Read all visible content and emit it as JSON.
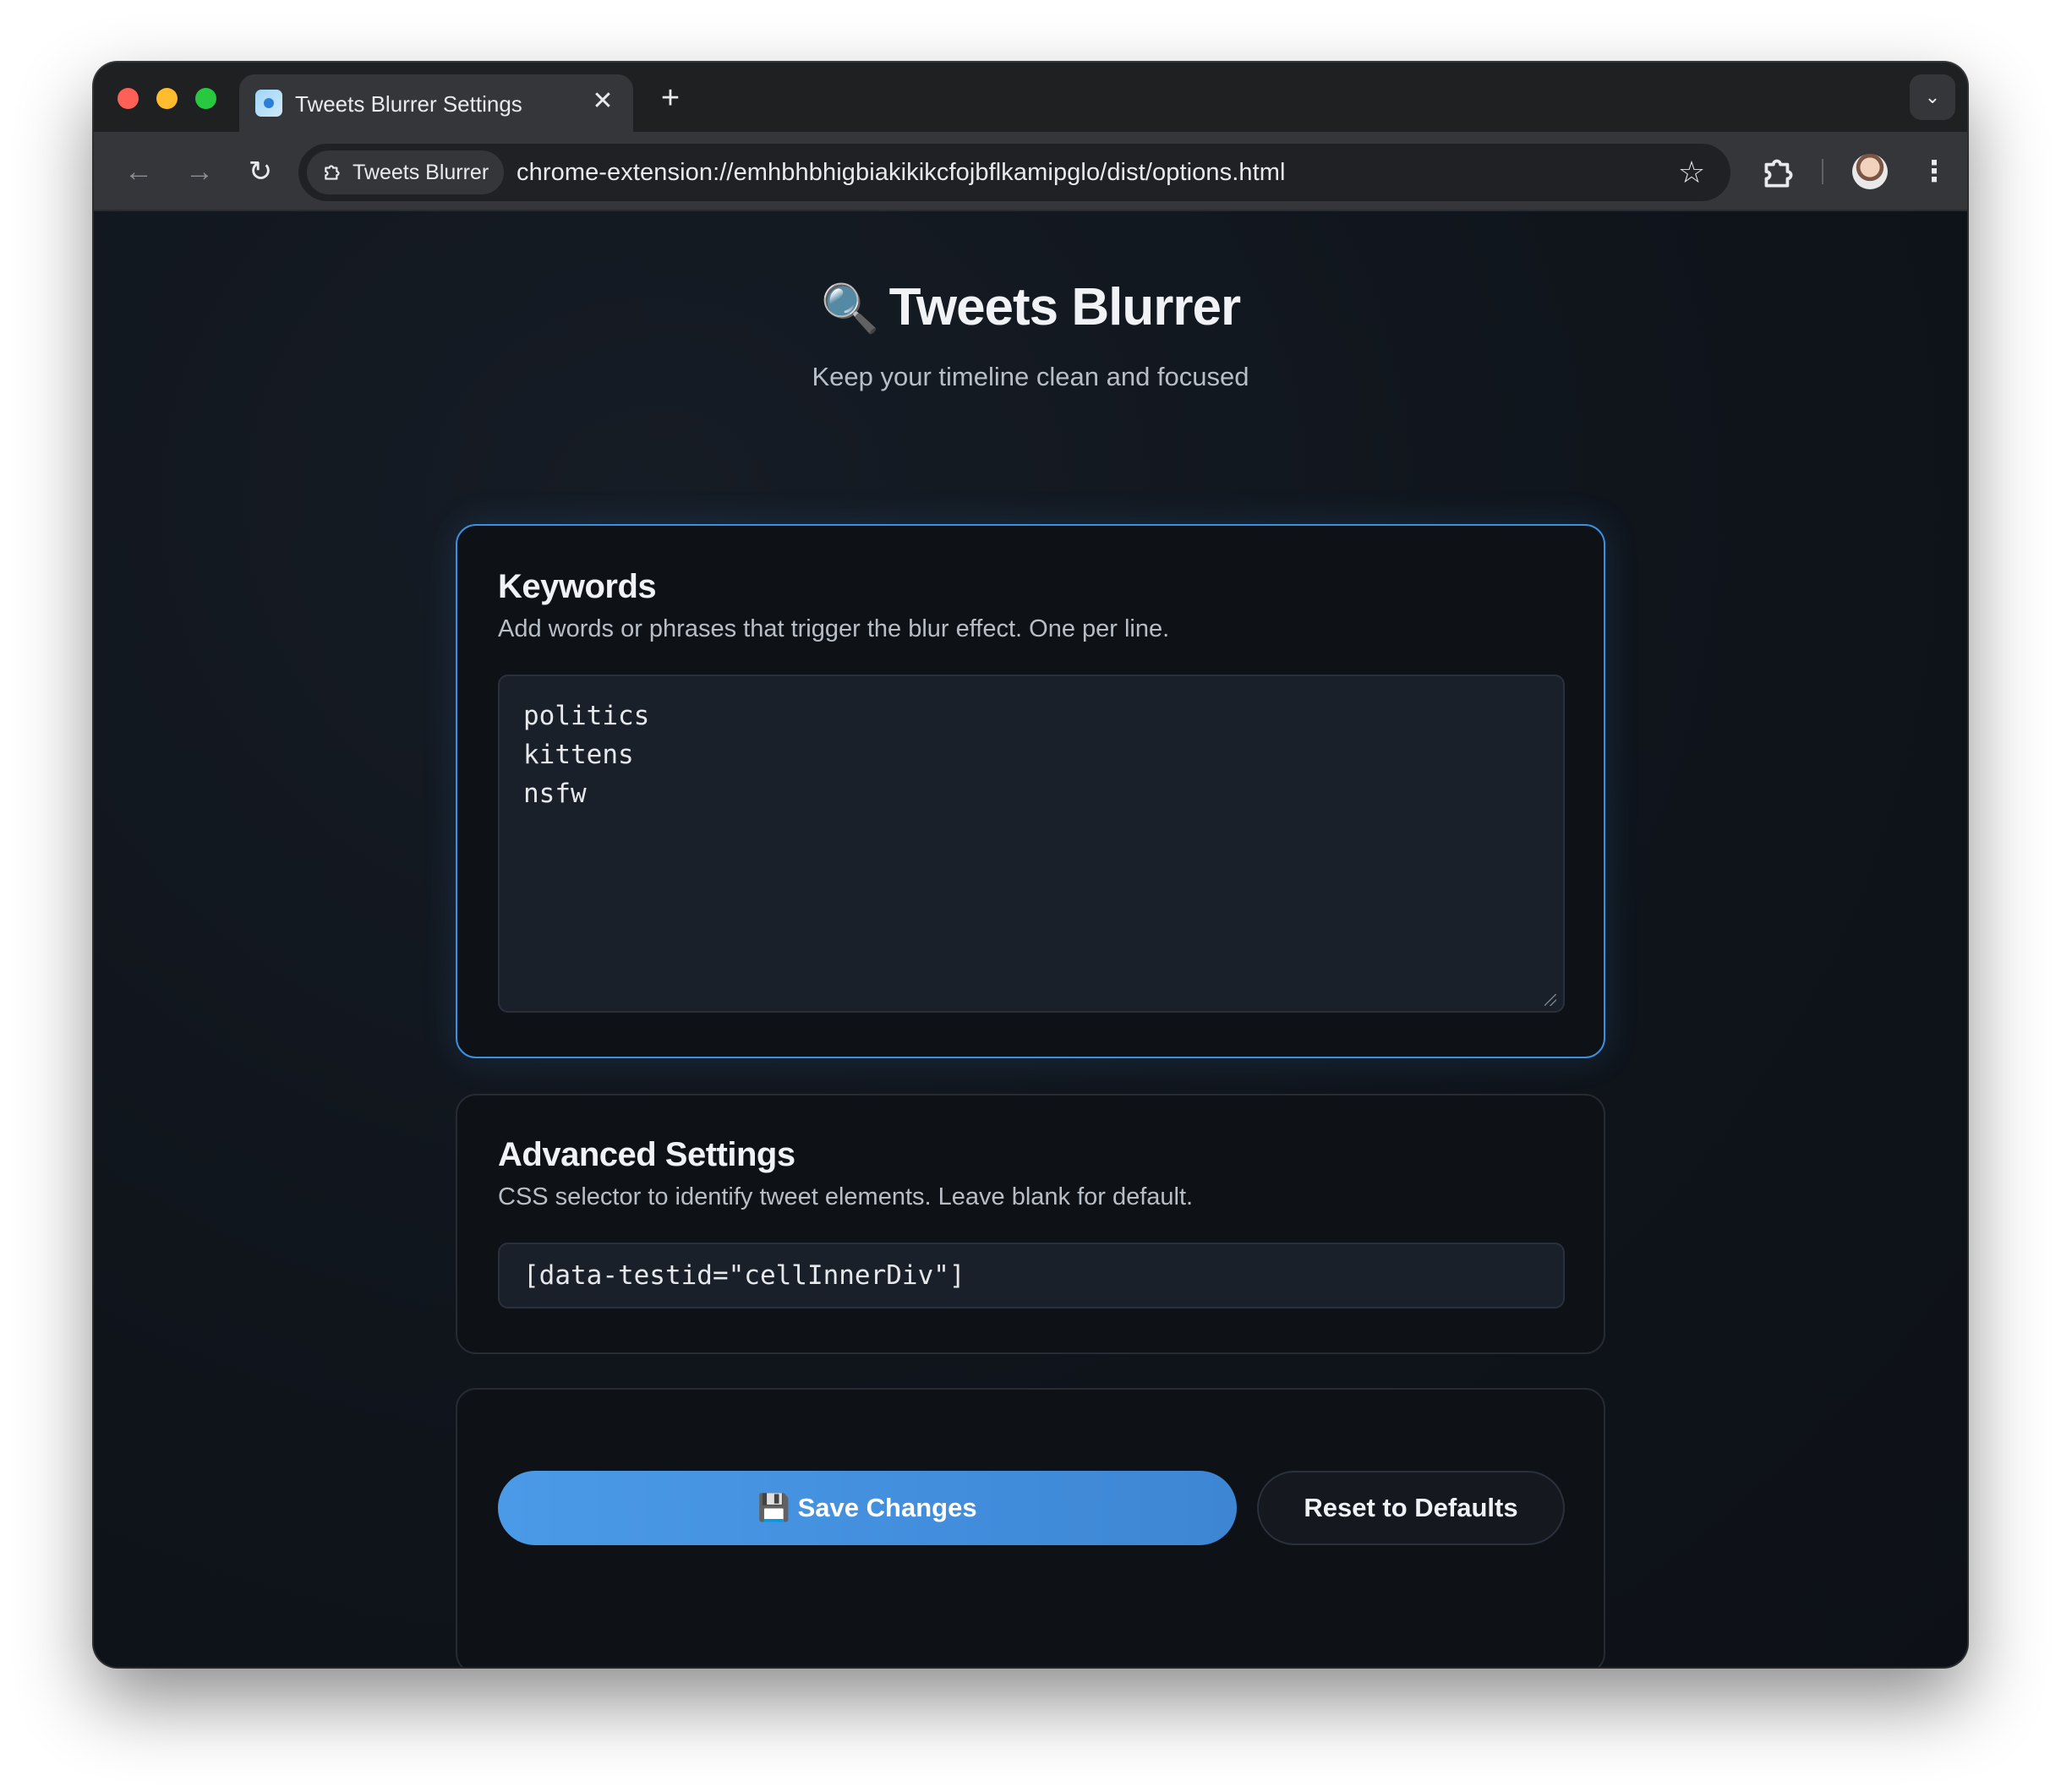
{
  "browser": {
    "tab_title": "Tweets Blurrer Settings",
    "tab_close": "✕",
    "new_tab": "+",
    "tab_search_icon": "⌄",
    "site_chip_label": "Tweets Blurrer",
    "url": "chrome-extension://emhbhbhigbiakikikcfojbflkamipglo/dist/options.html",
    "back_icon": "←",
    "forward_icon": "→",
    "reload_icon": "↻",
    "star_icon": "☆",
    "menu_icon": "⋮"
  },
  "header": {
    "icon": "🔍",
    "title": "Tweets Blurrer",
    "subtitle": "Keep your timeline clean and focused"
  },
  "keywords": {
    "title": "Keywords",
    "description": "Add words or phrases that trigger the blur effect. One per line.",
    "value": "politics\nkittens\nnsfw"
  },
  "advanced": {
    "title": "Advanced Settings",
    "description": "CSS selector to identify tweet elements. Leave blank for default.",
    "selector_value": "[data-testid=\"cellInnerDiv\"]"
  },
  "actions": {
    "save_label": "💾 Save Changes",
    "reset_label": "Reset to Defaults"
  },
  "colors": {
    "accent": "#3d8fe0",
    "save_button": "#4a9ae8",
    "page_background": "#0f141b"
  }
}
